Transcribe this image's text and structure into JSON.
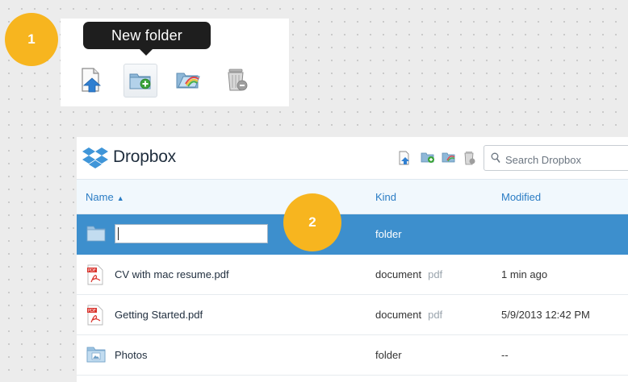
{
  "badges": {
    "step1": "1",
    "step2": "2"
  },
  "zoom_toolbar": {
    "tooltip": "New folder",
    "icons": [
      "upload-icon",
      "new-folder-icon",
      "share-folder-icon",
      "delete-icon"
    ],
    "active_icon": "new-folder-icon"
  },
  "dropbox": {
    "title": "Dropbox",
    "toolbar_icons": [
      "upload-icon",
      "new-folder-icon",
      "share-folder-icon",
      "delete-icon"
    ],
    "search": {
      "placeholder": "Search Dropbox",
      "value": ""
    },
    "columns": {
      "name": "Name",
      "sort_indicator": "▲",
      "kind": "Kind",
      "modified": "Modified"
    },
    "rows": [
      {
        "icon": "folder-icon",
        "name": "",
        "kind": "folder",
        "kind_sub": "",
        "modified": "",
        "selected": true,
        "editing": true
      },
      {
        "icon": "pdf-icon",
        "name": "CV with mac resume.pdf",
        "kind": "document",
        "kind_sub": "pdf",
        "modified": "1 min ago"
      },
      {
        "icon": "pdf-icon",
        "name": "Getting Started.pdf",
        "kind": "document",
        "kind_sub": "pdf",
        "modified": "5/9/2013 12:42 PM"
      },
      {
        "icon": "photos-folder-icon",
        "name": "Photos",
        "kind": "folder",
        "kind_sub": "",
        "modified": "--"
      }
    ]
  },
  "colors": {
    "badge": "#f7b51f",
    "selected_row": "#3d8fcd",
    "link_blue": "#2a7cc4",
    "tooltip_bg": "#1e1e1e"
  }
}
